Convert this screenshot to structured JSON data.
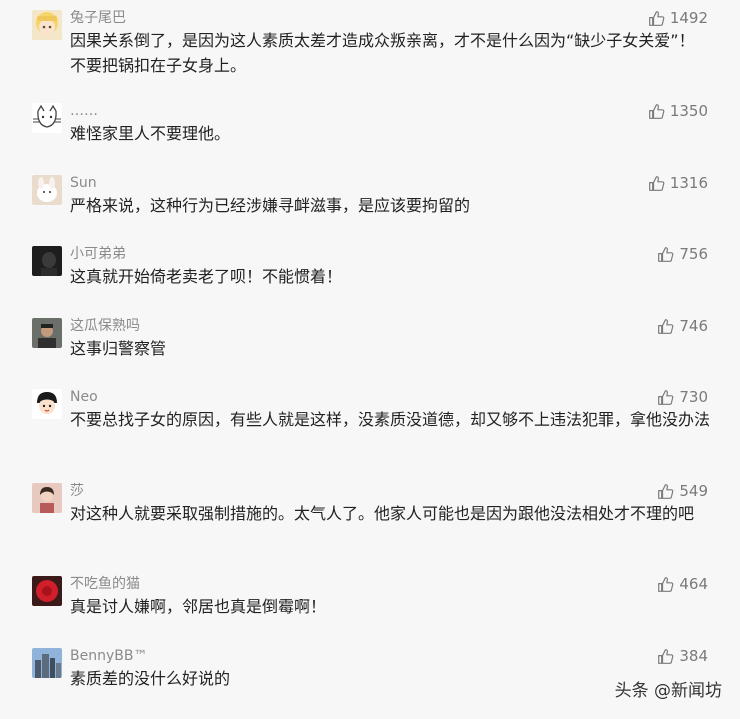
{
  "comments": [
    {
      "user": "兔子尾巴",
      "text": "因果关系倒了，是因为这人素质太差才造成众叛亲离，才不是什么因为“缺少子女关爱”！不要把锅扣在子女身上。",
      "likes": "1492",
      "avatar": "cartoon-girl-avatar"
    },
    {
      "user": "……",
      "text": "难怪家里人不要理他。",
      "likes": "1350",
      "avatar": "cat-sketch-avatar"
    },
    {
      "user": "Sun",
      "text": "严格来说，这种行为已经涉嫌寻衅滋事，是应该要拘留的",
      "likes": "1316",
      "avatar": "rabbit-photo-avatar"
    },
    {
      "user": "小可弟弟",
      "text": "这真就开始倚老卖老了呗！不能惯着！",
      "likes": "756",
      "avatar": "dark-portrait-avatar"
    },
    {
      "user": "这瓜保熟吗",
      "text": "这事归警察管",
      "likes": "746",
      "avatar": "man-photo-avatar"
    },
    {
      "user": "Neo",
      "text": "不要总找子女的原因，有些人就是这样，没素质没道德，却又够不上违法犯罪，拿他没办法",
      "likes": "730",
      "avatar": "cartoon-boy-avatar"
    },
    {
      "user": "莎",
      "text": "对这种人就要采取强制措施的。太气人了。他家人可能也是因为跟他没法相处才不理的吧",
      "likes": "549",
      "avatar": "woman-photo-avatar"
    },
    {
      "user": "不吃鱼的猫",
      "text": "真是讨人嫌啊，邻居也真是倒霉啊！",
      "likes": "464",
      "avatar": "red-flower-avatar"
    },
    {
      "user": "BennyBB™",
      "text": "素质差的没什么好说的",
      "likes": "384",
      "avatar": "city-photo-avatar"
    }
  ],
  "watermark": "头条 @新闻坊",
  "colors": {
    "background": "#f7f7f7",
    "username": "#8a8a8a",
    "text": "#222222",
    "likes": "#7a7a7a"
  }
}
